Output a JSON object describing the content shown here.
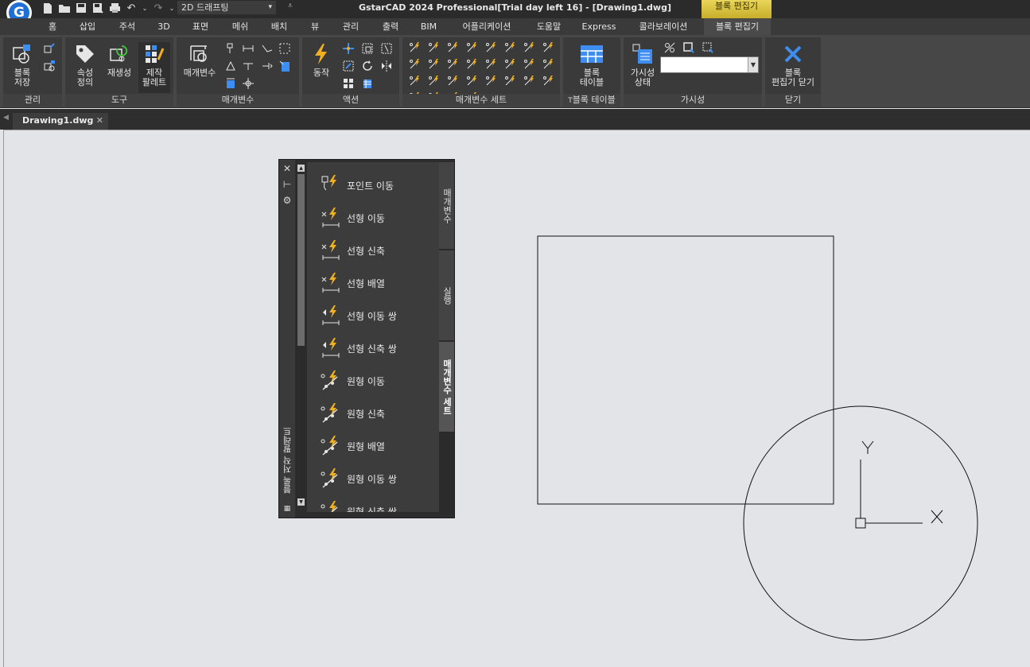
{
  "app": {
    "title": "GstarCAD 2024 Professional[Trial day left 16] - [Drawing1.dwg]",
    "context_tab_header": "블록 편집기",
    "workspace": "2D 드래프팅"
  },
  "tabs": [
    {
      "label": "홈"
    },
    {
      "label": "삽입"
    },
    {
      "label": "주석"
    },
    {
      "label": "3D"
    },
    {
      "label": "표면"
    },
    {
      "label": "메쉬"
    },
    {
      "label": "배치"
    },
    {
      "label": "뷰"
    },
    {
      "label": "관리"
    },
    {
      "label": "출력"
    },
    {
      "label": "BIM"
    },
    {
      "label": "어플리케이션"
    },
    {
      "label": "도움말"
    },
    {
      "label": "Express"
    },
    {
      "label": "콜라보레이션"
    },
    {
      "label": "블록 편집기"
    }
  ],
  "ribbon": {
    "groups": {
      "manage": "관리",
      "tools": "도구",
      "parameters": "매개변수",
      "actions": "액션",
      "param_sets": "매개변수 세트",
      "block_table": "블록 테이블",
      "visibility": "가시성",
      "close": "닫기"
    },
    "block_save": [
      "블록",
      "저장"
    ],
    "attr_def": [
      "속성",
      "정의"
    ],
    "regen": "재생성",
    "authoring_palette": [
      "제작",
      "팔레트"
    ],
    "parameter": "매개변수",
    "action": "동작",
    "block_table_btn": [
      "블록",
      "테이블"
    ],
    "vis_state": [
      "가시성",
      "상태"
    ],
    "close_editor": [
      "블록",
      "편집기 닫기"
    ],
    "vis_value": ""
  },
  "document": {
    "tab": "Drawing1.dwg"
  },
  "palette": {
    "title": "블록 저작 팔레트",
    "items": [
      "포인트 이동",
      "선형 이동",
      "선형 신축",
      "선형 배열",
      "선형 이동 쌍",
      "선형 신축 쌍",
      "원형 이동",
      "원형 신축",
      "원형 배열",
      "원형 이동 쌍",
      "원형 신축 쌍"
    ],
    "tabs": [
      "매개변수",
      "실행",
      "매개변수 세트"
    ]
  },
  "drawing": {
    "ucs_x": "X",
    "ucs_y": "Y"
  },
  "colors": {
    "accent_blue": "#3d8ef0",
    "action_yellow": "#f0b020",
    "context_gold": "#d8c23c"
  }
}
